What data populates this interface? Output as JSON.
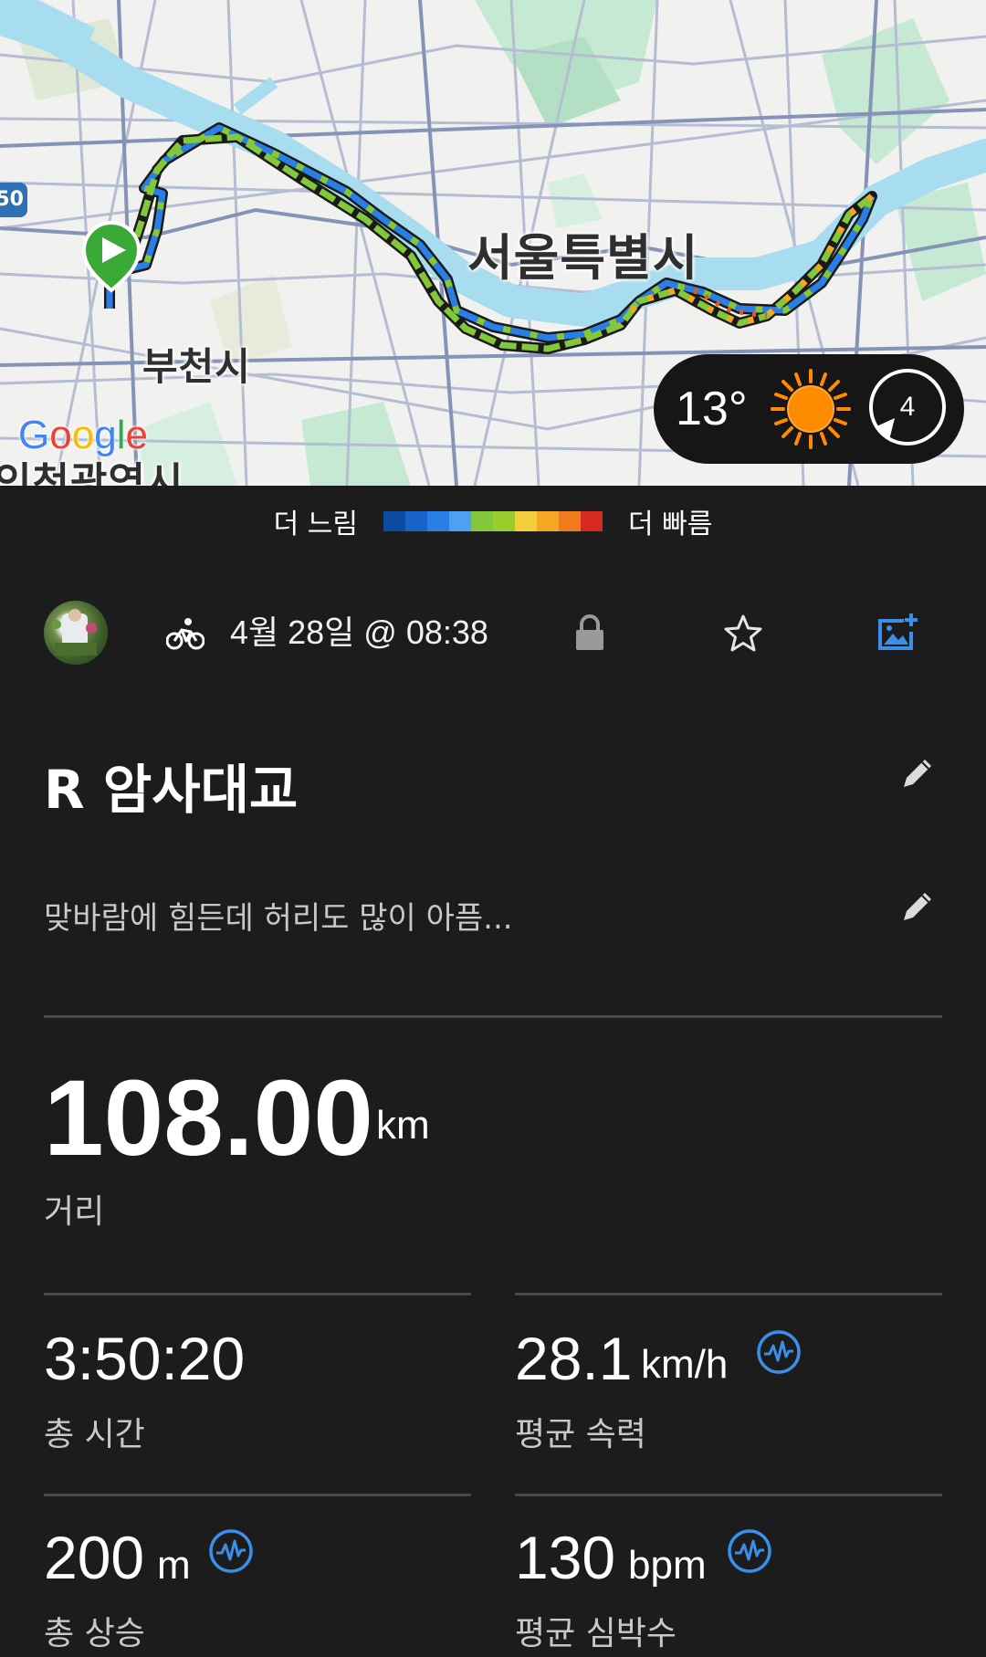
{
  "map": {
    "labels": {
      "seoul": "서울특별시",
      "bucheon": "부천시",
      "incheon_partial": "인천광역시",
      "highway_badge": "50"
    },
    "google_logo": [
      "G",
      "o",
      "o",
      "g",
      "l",
      "e"
    ],
    "weather": {
      "temperature": "13°",
      "wind_speed": "4",
      "icon": "sun-icon"
    },
    "colors": {
      "water": "#a8dcef",
      "park": "#c6e9d3",
      "road": "#8593b6",
      "route_start": "#3aa936"
    }
  },
  "legend": {
    "slower_label": "더 느림",
    "faster_label": "더 빠름",
    "colors": [
      "#0d4aa3",
      "#1763c7",
      "#2a7fe6",
      "#4fa0f2",
      "#83c73a",
      "#9bcc2d",
      "#f2cf3a",
      "#f5a623",
      "#ee7c1b",
      "#e35a1e",
      "#d62a20"
    ]
  },
  "header": {
    "activity_icon": "bike-icon",
    "date_time": "4월 28일 @ 08:38",
    "lock_icon": "lock-icon",
    "star_icon": "star-icon",
    "photo_icon": "add-photo-icon"
  },
  "activity": {
    "title": "R 암사대교",
    "notes": "맞바람에 힘든데 허리도 많이 아픔..."
  },
  "stats": {
    "distance": {
      "value": "108.00",
      "unit": "km",
      "label": "거리"
    },
    "total_time": {
      "value": "3:50:20",
      "label": "총 시간"
    },
    "avg_speed": {
      "value": "28.1",
      "unit": "km/h",
      "label": "평균 속력"
    },
    "total_ascent": {
      "value": "200",
      "unit": "m",
      "label": "총 상승"
    },
    "avg_hr": {
      "value": "130",
      "unit": "bpm",
      "label": "평균 심박수"
    }
  },
  "accent_color": "#3a8fe8"
}
